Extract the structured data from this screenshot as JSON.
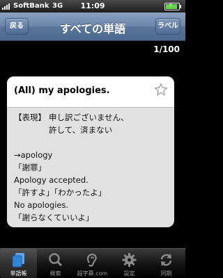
{
  "status_bar": {
    "carrier": "SoftBank",
    "network": "3G",
    "time": "11:09"
  },
  "nav": {
    "back_label": "戻る",
    "title": "すべての単語",
    "label_button": "ラベル"
  },
  "counter": "1/100",
  "card": {
    "title": "(All) my apologies.",
    "def_tag": "【表現】",
    "def_lines": [
      "申し訳ございません、",
      "許して、済まない"
    ],
    "notes": [
      "→apology",
      "「謝罪」",
      "Apology accepted.",
      "「許すよ」「わかったよ」",
      "No apologies.",
      "「謝らなくていいよ」"
    ]
  },
  "tabs": [
    {
      "label": "単語帳",
      "icon": "cards-icon",
      "active": true
    },
    {
      "label": "検索",
      "icon": "search-icon",
      "active": false
    },
    {
      "label": "超字幕.com",
      "icon": "ear-icon",
      "active": false
    },
    {
      "label": "設定",
      "icon": "gear-icon",
      "active": false
    },
    {
      "label": "同期",
      "icon": "sync-icon",
      "active": false
    }
  ],
  "colors": {
    "nav_blue": "#6b85a8",
    "card_bg": "#e1e1e1",
    "battery_green": "#63d64b"
  }
}
